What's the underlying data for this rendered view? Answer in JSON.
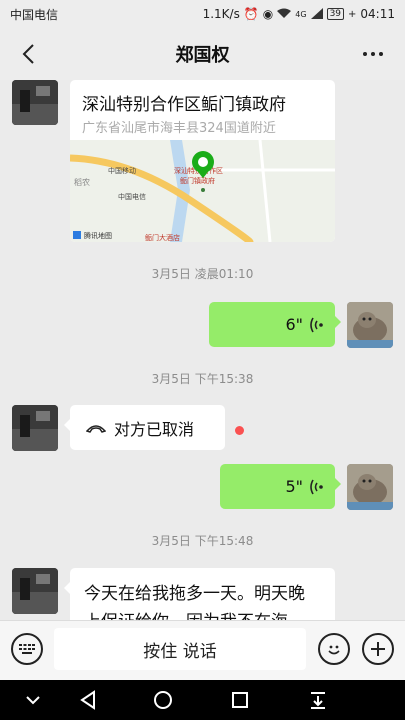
{
  "status_bar": {
    "carrier": "中国电信",
    "speed": "1.1K/s",
    "network": "4G",
    "battery": "39",
    "time": "04:11"
  },
  "header": {
    "title": "郑国权",
    "back_icon": "back-arrow-icon",
    "more_label": "···"
  },
  "messages": {
    "location": {
      "title": "深汕特别合作区鲘门镇政府",
      "address": "广东省汕尾市海丰县324国道附近",
      "map_labels": {
        "rice": "稻农",
        "china_mobile": "中国移动",
        "china_telecom": "中国电信",
        "pin_line1": "深汕特别合作区",
        "pin_line2": "鲘门镇政府",
        "hotel": "鲘门大酒店",
        "attribution": "腾讯地图"
      }
    },
    "time1": "3月5日 凌晨01:10",
    "voice1": "6\"",
    "time2": "3月5日 下午15:38",
    "call_cancelled": "对方已取消",
    "voice2": "5\"",
    "time3": "3月5日 下午15:48",
    "text_line1": "今天在给我拖多一天。明天晚",
    "text_line2": "上保证给你。因为我不在海"
  },
  "input_bar": {
    "hold_to_talk": "按住 说话"
  },
  "colors": {
    "green_bubble": "#95ec69",
    "background": "#ebebeb",
    "unread_dot": "#fa5151"
  }
}
